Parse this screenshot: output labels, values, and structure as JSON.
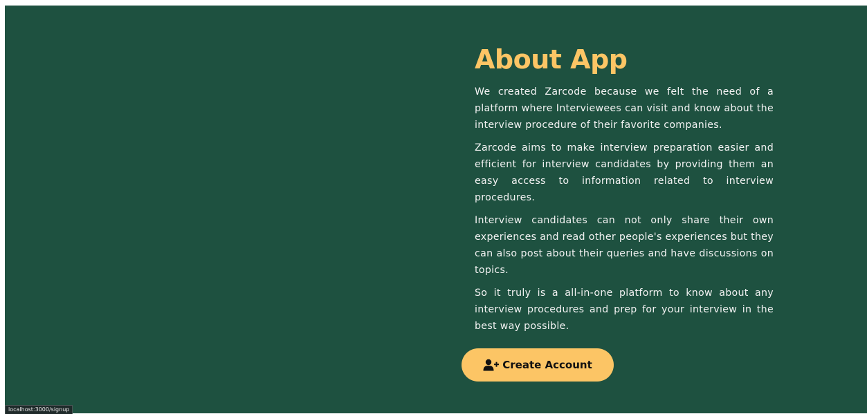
{
  "about": {
    "title": "About App",
    "paragraphs": [
      "We created Zarcode because we felt the need of a platform where Interviewees can visit and know about the interview procedure of their favorite companies.",
      "Zarcode aims to make interview preparation easier and efficient for interview candidates by providing them an easy access to information related to interview procedures.",
      "Interview candidates can not only share their own experiences and read other people's experiences but they can also post about their queries and have discussions on topics.",
      "So it truly is a all-in-one platform to know about any interview procedures and prep for your interview in the best way possible."
    ]
  },
  "cta": {
    "label": "Create Account",
    "icon": "user-plus-icon"
  },
  "status_bar": {
    "url": "localhost:3000/signup"
  },
  "colors": {
    "background": "#1e5140",
    "accent": "#fcc565",
    "body_text": "#f2f2f2"
  }
}
